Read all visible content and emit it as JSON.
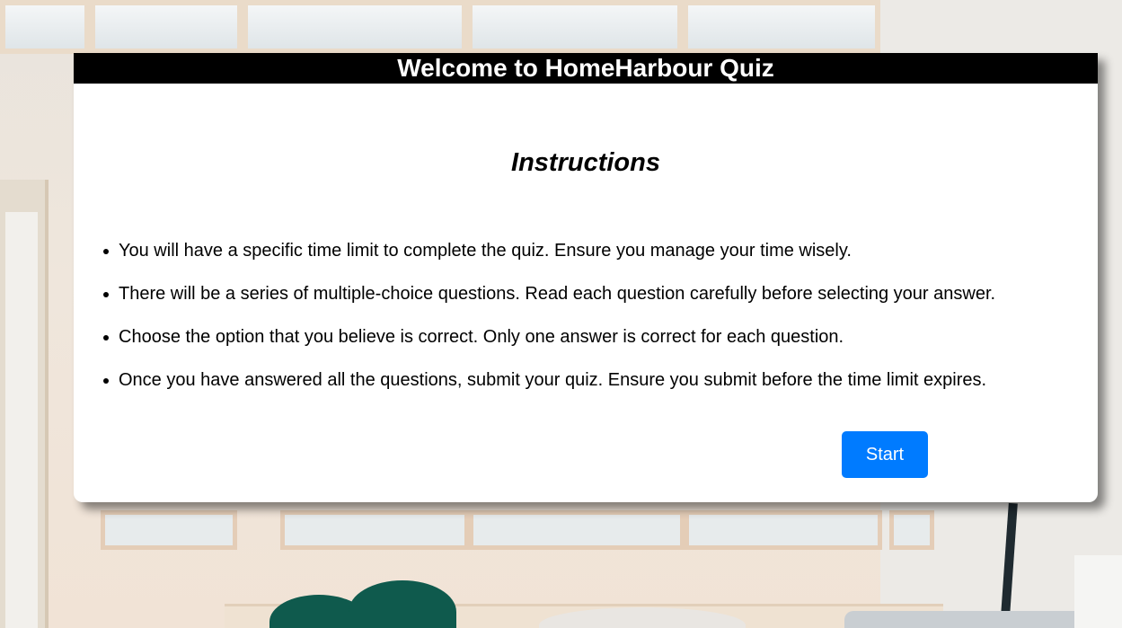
{
  "header": {
    "title": "Welcome to HomeHarbour Quiz"
  },
  "instructions": {
    "heading": "Instructions",
    "items": [
      "You will have a specific time limit to complete the quiz. Ensure you manage your time wisely.",
      "There will be a series of multiple-choice questions. Read each question carefully before selecting your answer.",
      "Choose the option that you believe is correct. Only one answer is correct for each question.",
      "Once you have answered all the questions, submit your quiz. Ensure you submit before the time limit expires."
    ]
  },
  "actions": {
    "start_label": "Start"
  },
  "colors": {
    "header_background": "#000000",
    "header_text": "#ffffff",
    "button_background": "#007bff",
    "card_background": "#ffffff"
  }
}
